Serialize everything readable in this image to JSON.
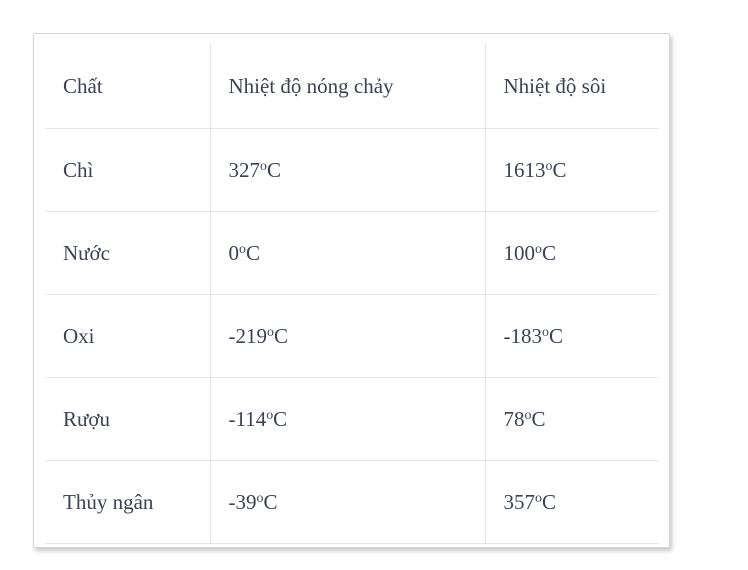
{
  "card": {
    "border_color": "#d7d7d7",
    "background": "#ffffff"
  },
  "table": {
    "name": "melting-and-boiling-point-table",
    "text_color": "#3c4250",
    "border_color": "#e6e6e6",
    "degree_symbol": "o",
    "unit": "C",
    "columns": [
      {
        "key": "substance",
        "label": "Chất"
      },
      {
        "key": "melting",
        "label": "Nhiệt độ nóng chảy"
      },
      {
        "key": "boiling",
        "label": "Nhiệt độ sôi"
      }
    ],
    "rows": [
      {
        "substance": "Chì",
        "melting_value": "327",
        "melting_deg": "o",
        "melting_unit": "C",
        "melting": "327oC",
        "boiling_value": "1613",
        "boiling_deg": "o",
        "boiling_unit": "C",
        "boiling": "1613oC"
      },
      {
        "substance": "Nước",
        "melting_value": "0",
        "melting_deg": "o",
        "melting_unit": "C",
        "melting": "0oC",
        "boiling_value": "100",
        "boiling_deg": "o",
        "boiling_unit": "C",
        "boiling": "100oC"
      },
      {
        "substance": "Oxi",
        "melting_value": "-219",
        "melting_deg": "o",
        "melting_unit": "C",
        "melting": "-219oC",
        "boiling_value": "-183",
        "boiling_deg": "o",
        "boiling_unit": "C",
        "boiling": "-183oC"
      },
      {
        "substance": "Rượu",
        "melting_value": "-114",
        "melting_deg": "o",
        "melting_unit": "C",
        "melting": "-114oC",
        "boiling_value": "78",
        "boiling_deg": "o",
        "boiling_unit": "C",
        "boiling": "78oC"
      },
      {
        "substance": "Thủy ngân",
        "melting_value": "-39",
        "melting_deg": "o",
        "melting_unit": "C",
        "melting": "-39oC",
        "boiling_value": "357",
        "boiling_deg": "o",
        "boiling_unit": "C",
        "boiling": "357oC"
      }
    ]
  }
}
